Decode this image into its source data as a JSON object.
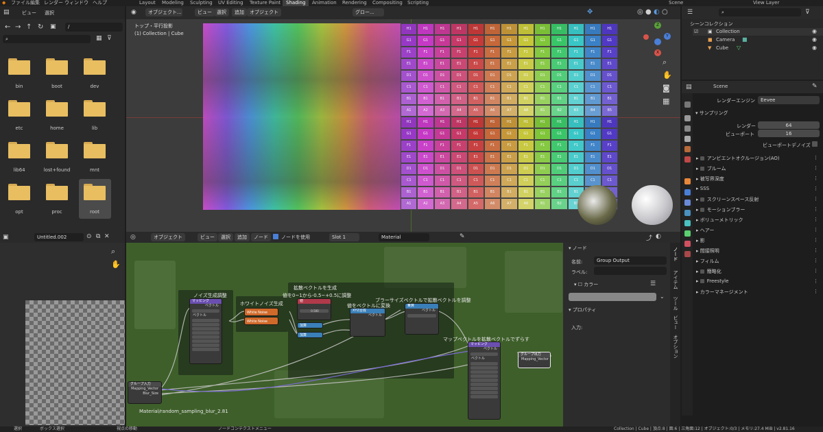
{
  "topbar": {
    "menus": [
      "ファイル",
      "編集",
      "レンダー",
      "ウィンドウ",
      "ヘルプ"
    ],
    "workspaces": [
      "Layout",
      "Modeling",
      "Sculpting",
      "UV Editing",
      "Texture Paint",
      "Shading",
      "Animation",
      "Rendering",
      "Compositing",
      "Scripting"
    ],
    "active_workspace": "Shading",
    "scene": "Scene",
    "view_layer": "View Layer"
  },
  "filebrowser": {
    "menus": [
      "ビュー",
      "選択"
    ],
    "path": "/",
    "folders": [
      "bin",
      "boot",
      "dev",
      "etc",
      "home",
      "lib",
      "lib64",
      "lost+found",
      "mnt",
      "opt",
      "proc",
      "root"
    ],
    "selected": "root"
  },
  "viewport": {
    "mode": "オブジェクト...",
    "menus": [
      "ビュー",
      "選択",
      "追加",
      "オブジェクト"
    ],
    "orientation": "グロー...",
    "view_name": "トップ・平行投影",
    "collection_info": "(1) Collection | Cube",
    "axes": {
      "z": "Z",
      "y": "Y",
      "x": "X"
    },
    "uv_rows": [
      "H1",
      "G1",
      "F1",
      "E1",
      "D1",
      "C1",
      "B1",
      "A1"
    ],
    "uv_cols": [
      "A1",
      "A2",
      "A3",
      "A4",
      "A5",
      "A6",
      "A7",
      "A8",
      "B1",
      "B2",
      "B3",
      "B4",
      "B5"
    ]
  },
  "outliner": {
    "title": "シーンコレクション",
    "items": [
      "Collection",
      "Camera",
      "Cube"
    ]
  },
  "properties": {
    "scene": "Scene",
    "render_engine_label": "レンダーエンジン",
    "render_engine": "Eevee",
    "sampling": "サンプリング",
    "render_label": "レンダー",
    "render_value": "64",
    "viewport_label": "ビューポート",
    "viewport_value": "16",
    "denoise": "ビューポートデノイズ",
    "sections": [
      "アンビエントオクルージョン(AO)",
      "ブルーム",
      "被写界深度",
      "SSS",
      "スクリーンスペース反射",
      "モーションブラー",
      "ボリューメトリック",
      "ヘアー",
      "影",
      "間接照明",
      "フィルム",
      "簡略化",
      "Freestyle",
      "カラーマネージメント"
    ]
  },
  "imageeditor": {
    "image_name": "Untitled.002"
  },
  "nodeeditor": {
    "mode": "オブジェクト",
    "menus": [
      "ビュー",
      "選択",
      "追加",
      "ノード"
    ],
    "use_nodes": "ノードを使用",
    "slot": "Slot 1",
    "material": "Material",
    "breadcrumb": "Material/random_sampling_blur_2.81",
    "frames": [
      "ノイズ生成調整",
      "ホワイトノイズ生成",
      "拡散ベクトルを生成",
      "値を0~1から-0.5~+0.5に調整",
      "値をベクトルに変換",
      "ブラーサイズベクトルで拡散ベクトルを調整",
      "マップベクトルを拡散ベクトルでずらす"
    ],
    "nodes": {
      "mapping1": "マッピング",
      "mapping2": "マッピング",
      "white1": "White Noise Text...",
      "white2": "White Noise Text...",
      "math": "値",
      "add1": "加算",
      "add2": "加算",
      "combine": "XYZ合成",
      "vecmath": "乗算",
      "group_in": "グループ入力",
      "group_out": "グループ出力",
      "mapping_vector": "Mapping_Vector",
      "blur_size": "Blur_Size",
      "vector": "ベクトル",
      "value": "0.500"
    }
  },
  "sidebar": {
    "tab_node": "ノード",
    "name_label": "名前:",
    "name_value": "Group Output",
    "label_label": "ラベル:",
    "color": "カラー",
    "properties": "プロパティ",
    "input": "入力:",
    "vtabs": [
      "ノード",
      "アイテム",
      "ツール",
      "ビュー",
      "オプション"
    ]
  },
  "statusbar": {
    "left": [
      "選択",
      "ボックス選択",
      "視点の移動"
    ],
    "center": "ノードコンテクストメニュー",
    "right": "Collection | Cube | 頂点:8 | 面:6 | 三角面:12 | オブジェクト:0/3 | メモリ:27.4 MiB | v2.81.16"
  }
}
